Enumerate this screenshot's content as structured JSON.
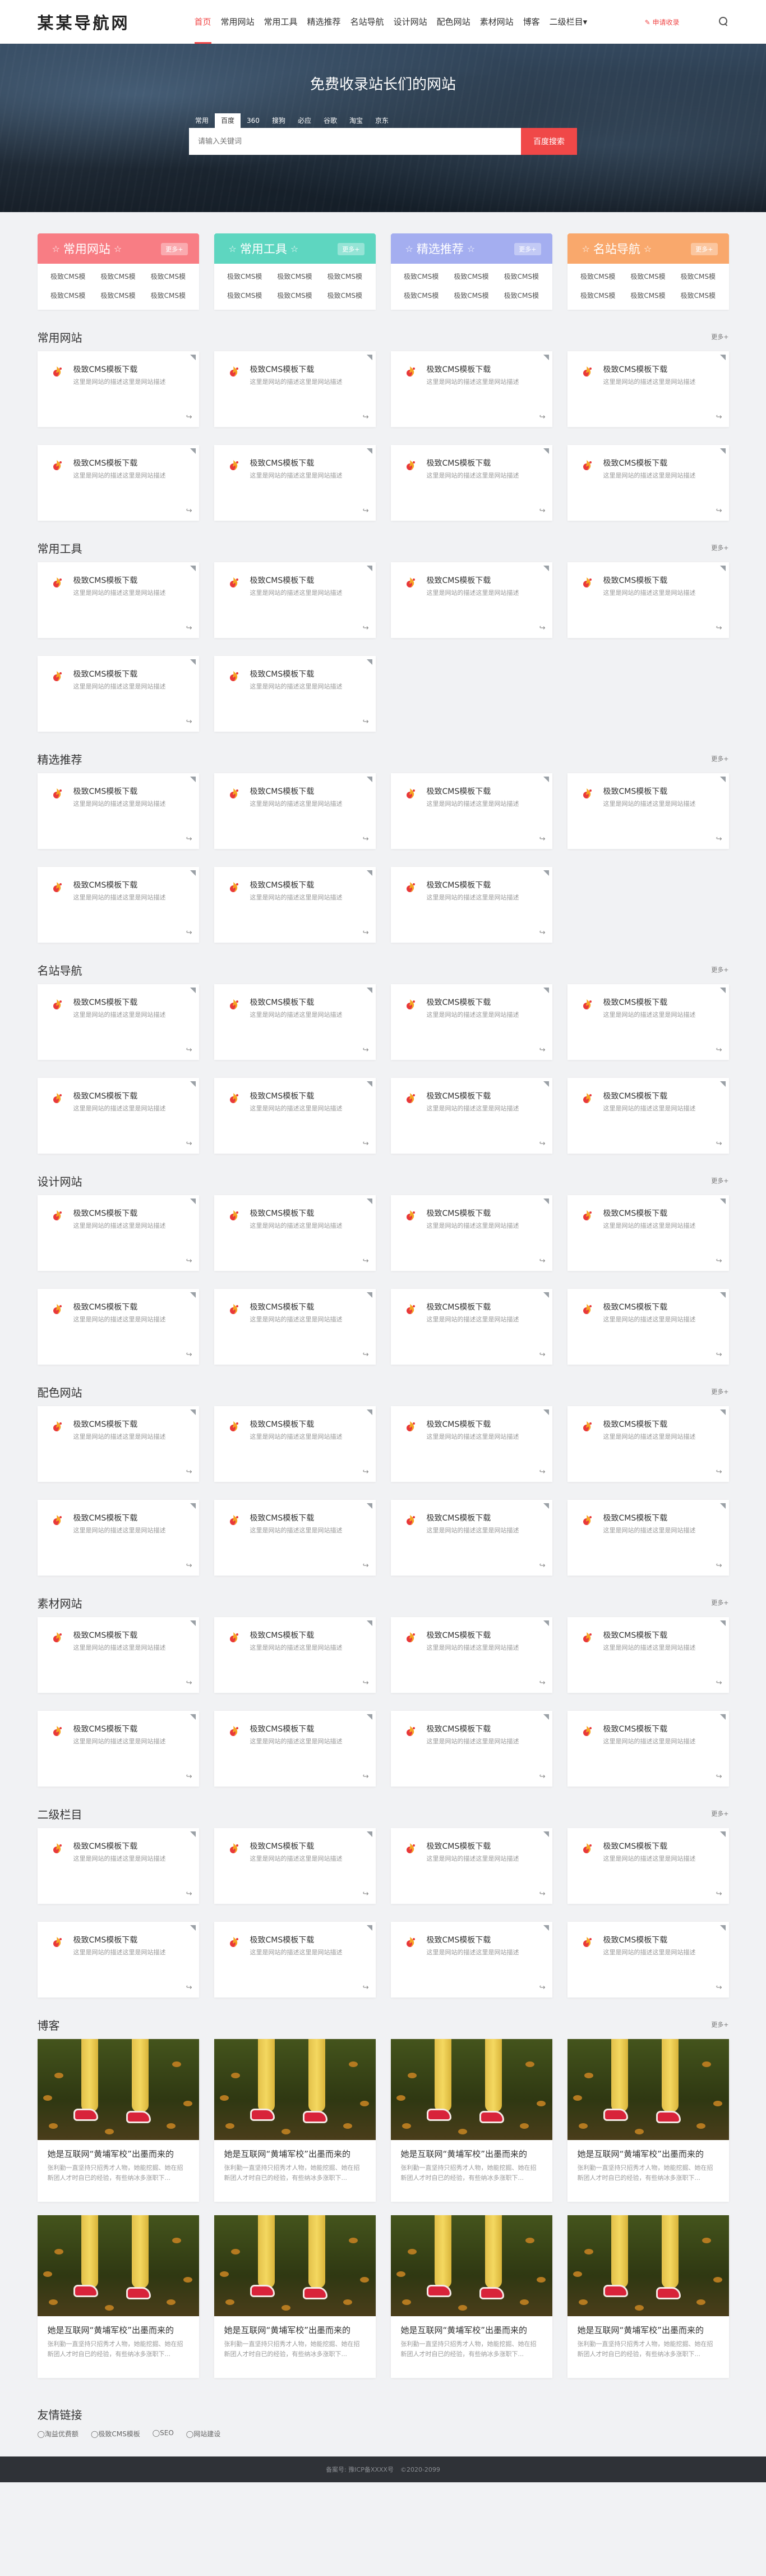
{
  "header": {
    "logo": "某某导航网",
    "nav": [
      {
        "label": "首页",
        "active": true
      },
      {
        "label": "常用网站"
      },
      {
        "label": "常用工具"
      },
      {
        "label": "精选推荐"
      },
      {
        "label": "名站导航"
      },
      {
        "label": "设计网站"
      },
      {
        "label": "配色网站"
      },
      {
        "label": "素材网站"
      },
      {
        "label": "博客"
      },
      {
        "label": "二级栏目▾"
      }
    ],
    "submit": "✎ 申请收录",
    "search_icon": "search-icon"
  },
  "hero": {
    "title": "免费收录站长们的网站",
    "tabs": [
      "常用",
      "百度",
      "360",
      "搜狗",
      "必应",
      "谷歌",
      "淘宝",
      "京东"
    ],
    "active_tab": "百度",
    "placeholder": "请输入关键词",
    "button": "百度搜索"
  },
  "quick": [
    {
      "title": "常用网站",
      "more": "更多+",
      "color": "#f87d84",
      "links": [
        "极致CMS模",
        "极致CMS模",
        "极致CMS模",
        "极致CMS模",
        "极致CMS模",
        "极致CMS模"
      ]
    },
    {
      "title": "常用工具",
      "more": "更多+",
      "color": "#5ed6c0",
      "links": [
        "极致CMS模",
        "极致CMS模",
        "极致CMS模",
        "极致CMS模",
        "极致CMS模",
        "极致CMS模"
      ]
    },
    {
      "title": "精选推荐",
      "more": "更多+",
      "color": "#a4aef0",
      "links": [
        "极致CMS模",
        "极致CMS模",
        "极致CMS模",
        "极致CMS模",
        "极致CMS模",
        "极致CMS模"
      ]
    },
    {
      "title": "名站导航",
      "more": "更多+",
      "color": "#f9a86c",
      "links": [
        "极致CMS模",
        "极致CMS模",
        "极致CMS模",
        "极致CMS模",
        "极致CMS模",
        "极致CMS模"
      ]
    }
  ],
  "card": {
    "name": "极致CMS模板下载",
    "desc": "这里是网站的描述这里是网站描述",
    "icon": "flame-logo-icon",
    "share": "↪"
  },
  "sections": [
    {
      "title": "常用网站",
      "more": "更多+",
      "count": 8
    },
    {
      "title": "常用工具",
      "more": "更多+",
      "count": 6
    },
    {
      "title": "精选推荐",
      "more": "更多+",
      "count": 7
    },
    {
      "title": "名站导航",
      "more": "更多+",
      "count": 8
    },
    {
      "title": "设计网站",
      "more": "更多+",
      "count": 8
    },
    {
      "title": "配色网站",
      "more": "更多+",
      "count": 8
    },
    {
      "title": "素材网站",
      "more": "更多+",
      "count": 8
    },
    {
      "title": "二级栏目",
      "more": "更多+",
      "count": 8
    }
  ],
  "blog": {
    "title": "博客",
    "more": "更多+",
    "post_title": "她是互联网“黄埔军校”出墨而来的",
    "post_desc": "张利勤一直坚持只招秀才人物，她能挖掘、她在招新团人才时自已的经验，有些纳冰多涨职下...",
    "count": 8
  },
  "links": {
    "title": "友情链接",
    "items": [
      "◯淘益优费额",
      "◯极致CMS模板",
      "◯SEO",
      "◯网站建设"
    ]
  },
  "footer": {
    "icp": "备案号: 豫ICP备XXXX号",
    "copy": "©2020-2099"
  }
}
